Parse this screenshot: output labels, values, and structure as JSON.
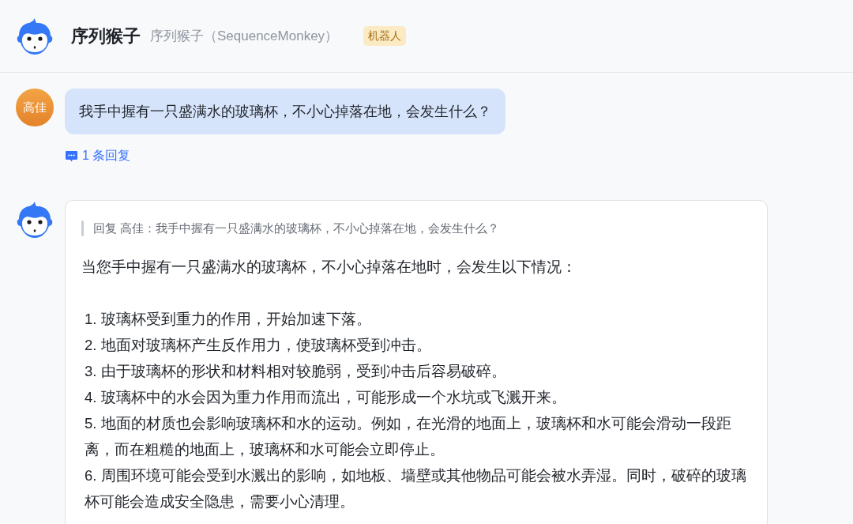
{
  "header": {
    "title": "序列猴子",
    "subtitle": "序列猴子（SequenceMonkey）",
    "badge": "机器人"
  },
  "messages": [
    {
      "kind": "user",
      "avatar_text": "高佳",
      "text": "我手中握有一只盛满水的玻璃杯，不小心掉落在地，会发生什么？",
      "replies": "1 条回复"
    },
    {
      "kind": "bot",
      "quote": "回复 高佳：我手中握有一只盛满水的玻璃杯，不小心掉落在地，会发生什么？",
      "intro": "当您手中握有一只盛满水的玻璃杯，不小心掉落在地时，会发生以下情况：",
      "items": [
        "1. 玻璃杯受到重力的作用，开始加速下落。",
        "2. 地面对玻璃杯产生反作用力，使玻璃杯受到冲击。",
        "3. 由于玻璃杯的形状和材料相对较脆弱，受到冲击后容易破碎。",
        "4. 玻璃杯中的水会因为重力作用而流出，可能形成一个水坑或飞溅开来。",
        "5. 地面的材质也会影响玻璃杯和水的运动。例如，在光滑的地面上，玻璃杯和水可能会滑动一段距离，而在粗糙的地面上，玻璃杯和水可能会立即停止。",
        "6. 周围环境可能会受到水溅出的影响，如地板、墙壁或其他物品可能会被水弄湿。同时，破碎的玻璃杯可能会造成安全隐患，需要小心清理。"
      ]
    }
  ]
}
